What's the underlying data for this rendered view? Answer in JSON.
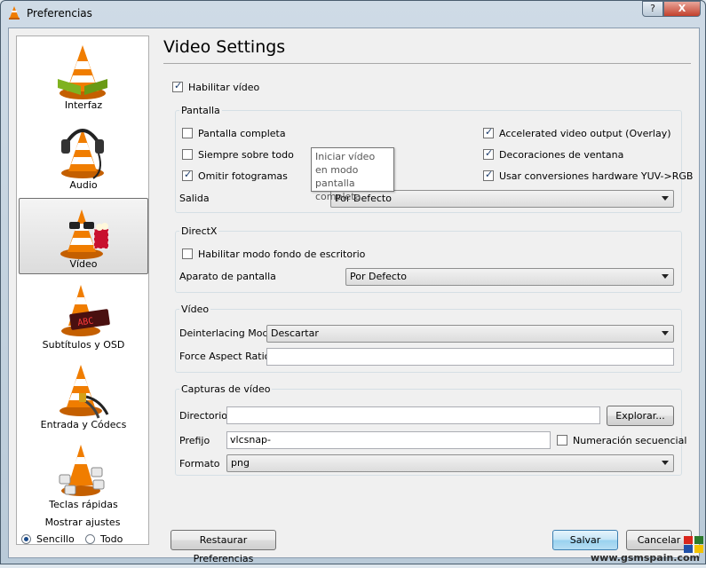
{
  "window": {
    "title": "Preferencias",
    "help_label": "?",
    "close_label": "X"
  },
  "sidebar": {
    "items": [
      {
        "label": "Interfaz"
      },
      {
        "label": "Audio"
      },
      {
        "label": "Vídeo"
      },
      {
        "label": "Subtítulos y OSD"
      },
      {
        "label": "Entrada y Códecs"
      },
      {
        "label": "Teclas rápidas"
      }
    ],
    "selected": "Vídeo",
    "show_settings": {
      "legend": "Mostrar ajustes",
      "simple": "Sencillo",
      "all": "Todo",
      "selected": "Sencillo"
    }
  },
  "main": {
    "heading": "Video Settings",
    "enable_video": {
      "label": "Habilitar vídeo",
      "checked": true
    },
    "pantalla": {
      "title": "Pantalla",
      "fullscreen": {
        "label": "Pantalla completa",
        "checked": false
      },
      "always_on_top": {
        "label": "Siempre sobre todo",
        "checked": false
      },
      "drop_frames": {
        "label": "Omitir fotogramas",
        "checked": true
      },
      "overlay": {
        "label": "Accelerated video output (Overlay)",
        "checked": true
      },
      "decorations": {
        "label": "Decoraciones de ventana",
        "checked": true
      },
      "yuv_rgb": {
        "label": "Usar conversiones hardware YUV->RGB",
        "checked": true
      },
      "output_label": "Salida",
      "output_value": "Por Defecto"
    },
    "tooltip": "Iniciar vídeo en modo pantalla completa",
    "directx": {
      "title": "DirectX",
      "wallpaper": {
        "label": "Habilitar modo fondo de escritorio",
        "checked": false
      },
      "device_label": "Aparato de pantalla",
      "device_value": "Por Defecto"
    },
    "video": {
      "title": "Vídeo",
      "deinterlace_label": "Deinterlacing Mode",
      "deinterlace_value": "Descartar",
      "aspect_label": "Force Aspect Ratio",
      "aspect_value": ""
    },
    "snapshots": {
      "title": "Capturas de vídeo",
      "dir_label": "Directorio",
      "dir_value": "",
      "browse_label": "Explorar...",
      "prefix_label": "Prefijo",
      "prefix_value": "vlcsnap-",
      "sequential": {
        "label": "Numeración secuencial",
        "checked": false
      },
      "format_label": "Formato",
      "format_value": "png"
    }
  },
  "footer": {
    "reset_label": "Restaurar Preferencias",
    "save_label": "Salvar",
    "cancel_label": "Cancelar"
  },
  "watermark": "www.gsmspain.com",
  "colors": {
    "cone_orange": "#f07d00",
    "selection_border": "#6f6f6f",
    "default_button": "#3c7fb1"
  }
}
